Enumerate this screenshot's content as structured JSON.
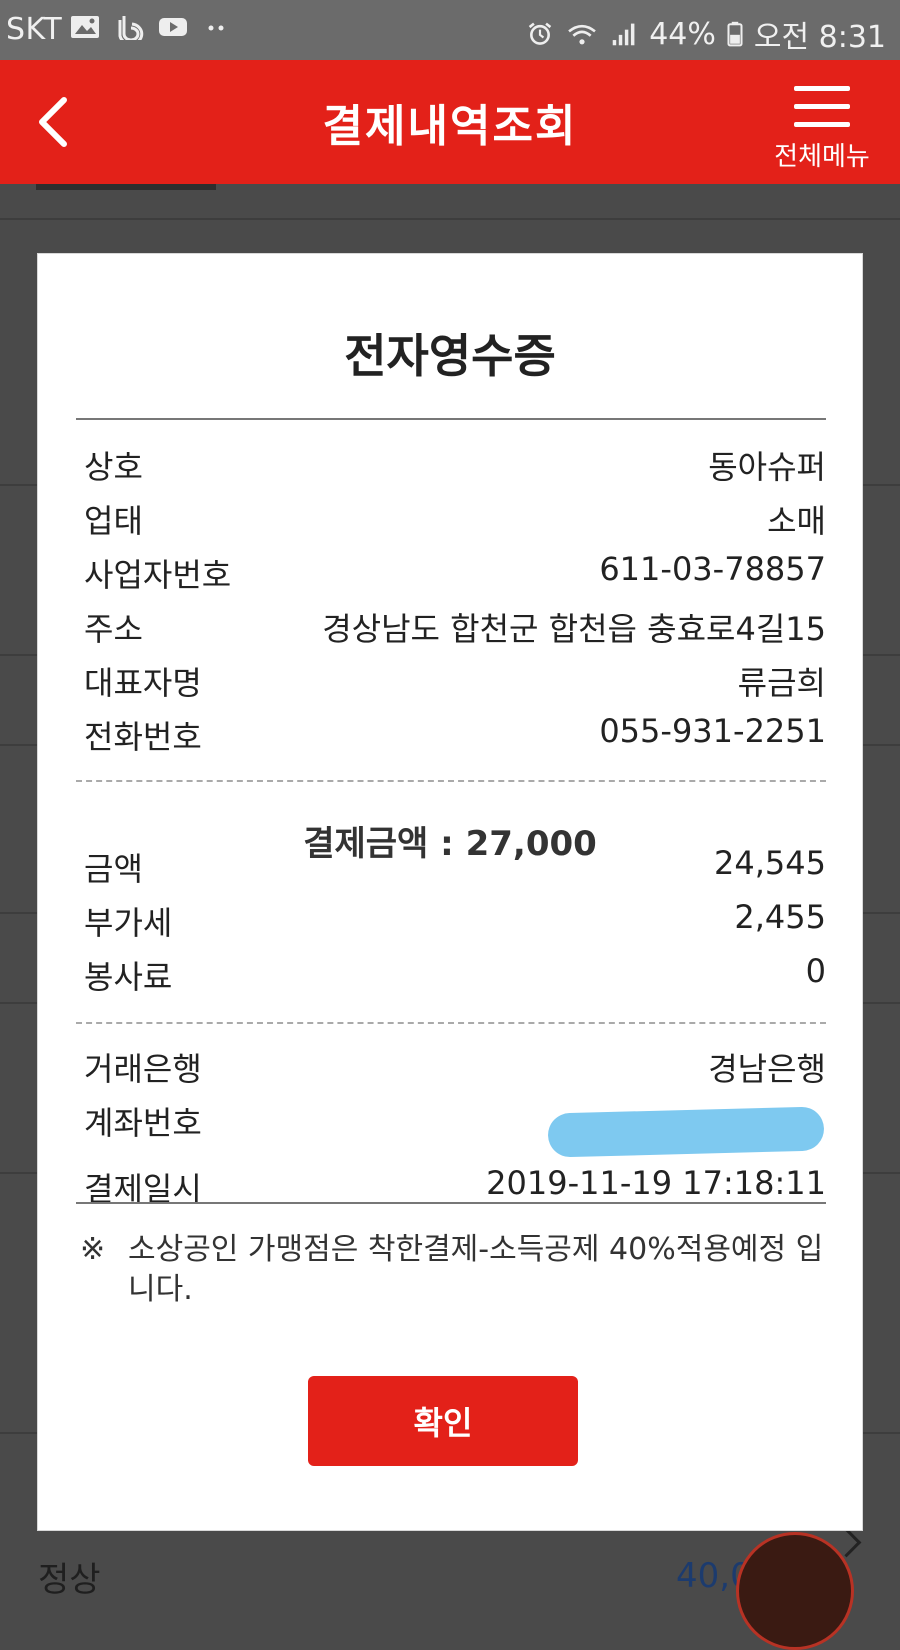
{
  "status_bar": {
    "carrier": "SKT",
    "battery": "44%",
    "time": "오전 8:31"
  },
  "header": {
    "title": "결제내역조회",
    "menu_label": "전체메뉴"
  },
  "background": {
    "row_status": "정상",
    "row_amount": "40,0"
  },
  "receipt": {
    "title": "전자영수증",
    "store_info": [
      {
        "label": "상호",
        "value": "동아슈퍼"
      },
      {
        "label": "업태",
        "value": "소매"
      },
      {
        "label": "사업자번호",
        "value": "611-03-78857"
      },
      {
        "label": "주소",
        "value": "경상남도 합천군 합천읍 충효로4길15"
      },
      {
        "label": "대표자명",
        "value": "류금희"
      },
      {
        "label": "전화번호",
        "value": "055-931-2251"
      }
    ],
    "payment_amount": "결제금액 : 27,000",
    "amount_rows": [
      {
        "label": "금액",
        "value": "24,545"
      },
      {
        "label": "부가세",
        "value": "2,455"
      },
      {
        "label": "봉사료",
        "value": "0"
      }
    ],
    "bank_rows": [
      {
        "label": "거래은행",
        "value": "경남은행"
      },
      {
        "label": "계좌번호",
        "value": ""
      }
    ],
    "payment_datetime": {
      "label": "결제일시",
      "value": "2019-11-19 17:18:11"
    },
    "note_mark": "※",
    "note": "소상공인 가맹점은 착한결제-소득공제 40%적용예정 입니다.",
    "confirm_label": "확인"
  },
  "colors": {
    "brand_red": "#e32119",
    "redaction": "#7ec9f0"
  }
}
